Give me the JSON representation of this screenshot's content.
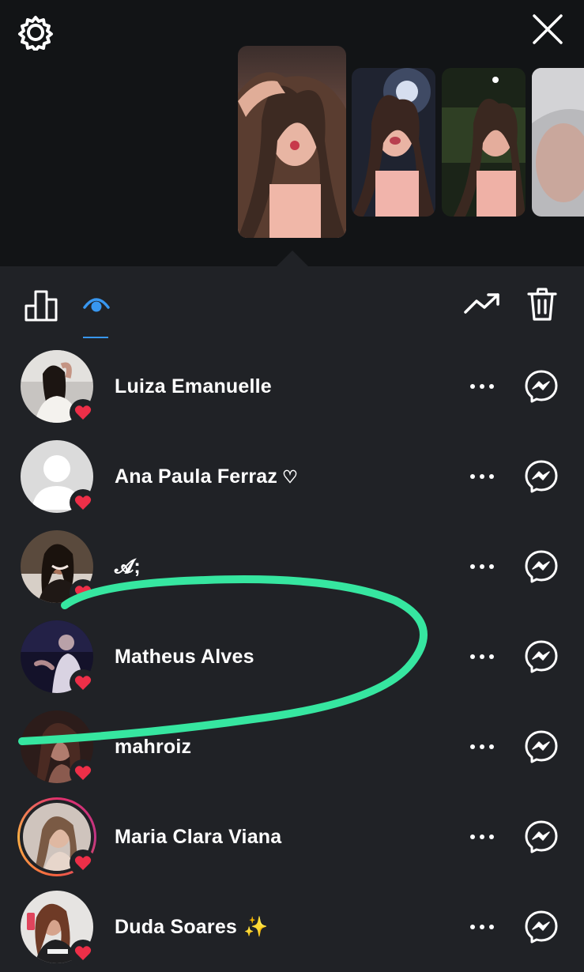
{
  "toolbar": {
    "active_tab": "viewers",
    "accent_color": "#3897f0"
  },
  "viewers": [
    {
      "name": "Luiza Emanuelle",
      "suffix": "",
      "liked": true,
      "story_ring": false
    },
    {
      "name": "Ana Paula Ferraz",
      "suffix": "♡",
      "liked": true,
      "story_ring": false
    },
    {
      "name": "𝓐;",
      "suffix": "",
      "liked": true,
      "story_ring": false
    },
    {
      "name": "Matheus Alves",
      "suffix": "",
      "liked": true,
      "story_ring": false
    },
    {
      "name": "mahroiz",
      "suffix": "",
      "liked": true,
      "story_ring": false
    },
    {
      "name": "Maria Clara Viana",
      "suffix": "",
      "liked": true,
      "story_ring": true
    },
    {
      "name": "Duda Soares",
      "suffix": "✨",
      "liked": true,
      "story_ring": false
    }
  ],
  "colors": {
    "background": "#202226",
    "header_background": "#121416",
    "like_red": "#ed2f48",
    "highlight_marker": "#36e6a0"
  }
}
